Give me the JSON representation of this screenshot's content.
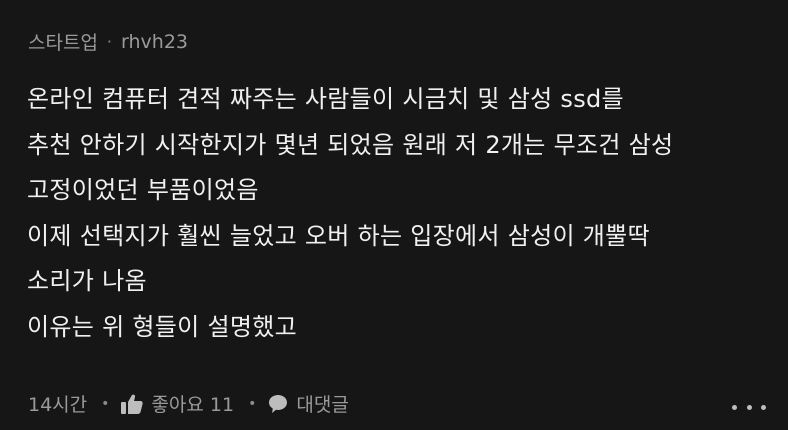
{
  "comment": {
    "author_badge": "스타트업",
    "username": "rhvh23",
    "lines": [
      "온라인 컴퓨터 견적 짜주는 사람들이 시금치 및 삼성 ssd를",
      "추천 안하기 시작한지가 몇년 되었음 원래 저 2개는 무조건 삼성",
      "고정이었던 부품이었음",
      "이제 선택지가 훨씬 늘었고 오버 하는 입장에서 삼성이 개뿔딱",
      "소리가 나옴",
      "이유는 위 형들이 설명했고"
    ],
    "time": "14시간",
    "like_label": "좋아요",
    "like_count": "11",
    "reply_label": "대댓글"
  },
  "icons": {
    "like": "thumbs-up-icon",
    "reply": "speech-bubble-icon",
    "more": "more-dots-icon"
  },
  "colors": {
    "background": "#161616",
    "text": "#f0f0f0",
    "muted": "#9a9a9a"
  }
}
